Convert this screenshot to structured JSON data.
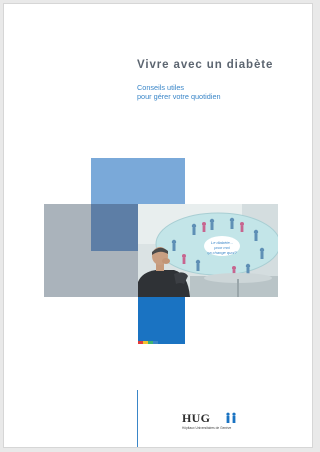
{
  "cover": {
    "title": "Vivre avec un diabète",
    "subtitle_lines": [
      "Conseils utiles",
      "pour gérer votre quotidien"
    ],
    "photo": {
      "screen_caption_lines": [
        "Le diabète...",
        "pour moi",
        "ça change quoi?"
      ]
    },
    "publisher": {
      "logo_word": "HUG",
      "full_name": "Hôpitaux Universitaires de Genève"
    }
  },
  "colors": {
    "title": "#5c6570",
    "accent_blue": "#3a86c8",
    "light_blue_square": "#7aa9d9",
    "grey_square": "#aab3bb",
    "overlap_square": "#5d7ea6",
    "deep_blue_square": "#1a73c2",
    "color_strip": [
      "#e23b3b",
      "#f2c230",
      "#3cb371",
      "#3a86c8"
    ]
  }
}
